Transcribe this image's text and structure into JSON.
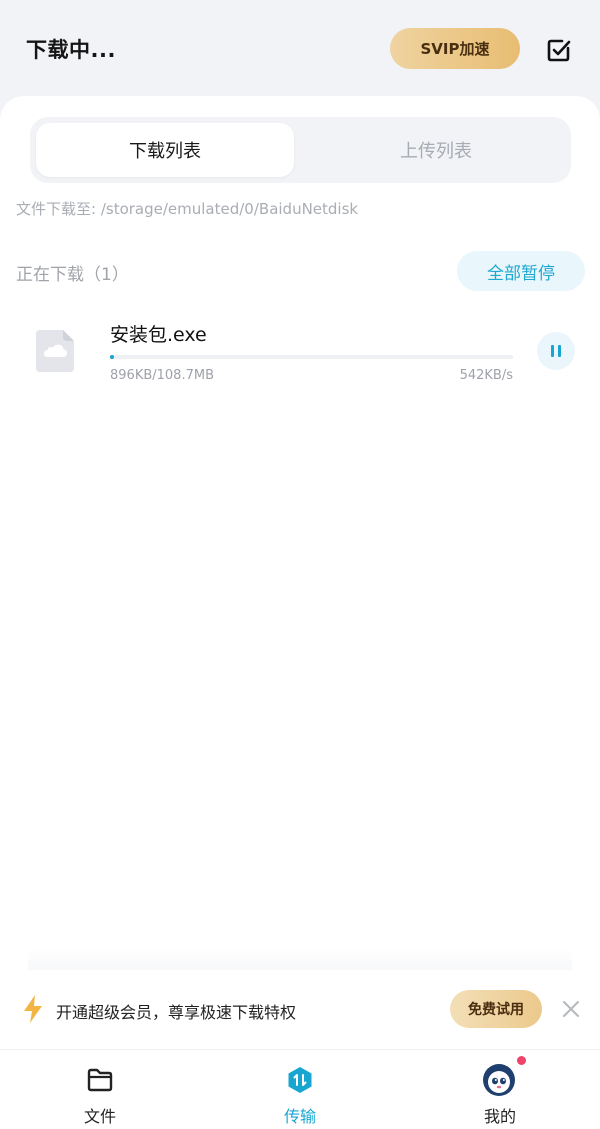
{
  "header": {
    "title": "下载中...",
    "svip_label": "SVIP加速"
  },
  "tabs": {
    "download_list": "下载列表",
    "upload_list": "上传列表"
  },
  "path_text": "文件下载至: /storage/emulated/0/BaiduNetdisk",
  "section": {
    "label": "正在下载（1）",
    "pause_all_label": "全部暂停"
  },
  "download_item": {
    "name": "安装包.exe",
    "size": "896KB/108.7MB",
    "speed": "542KB/s",
    "progress_fraction": 0.008
  },
  "promo": {
    "text": "开通超级会员，尊享极速下载特权",
    "trial_label": "免费试用"
  },
  "bottom_nav": {
    "items": [
      {
        "label": "文件",
        "icon": "folder-icon"
      },
      {
        "label": "传输",
        "icon": "transfer-icon"
      },
      {
        "label": "我的",
        "icon": "avatar-icon"
      }
    ],
    "active": "传输"
  },
  "colors": {
    "accent": "#18a6d1",
    "gold_start": "#efd3a0",
    "gold_end": "#e8bd72",
    "badge_red": "#f0436b"
  }
}
